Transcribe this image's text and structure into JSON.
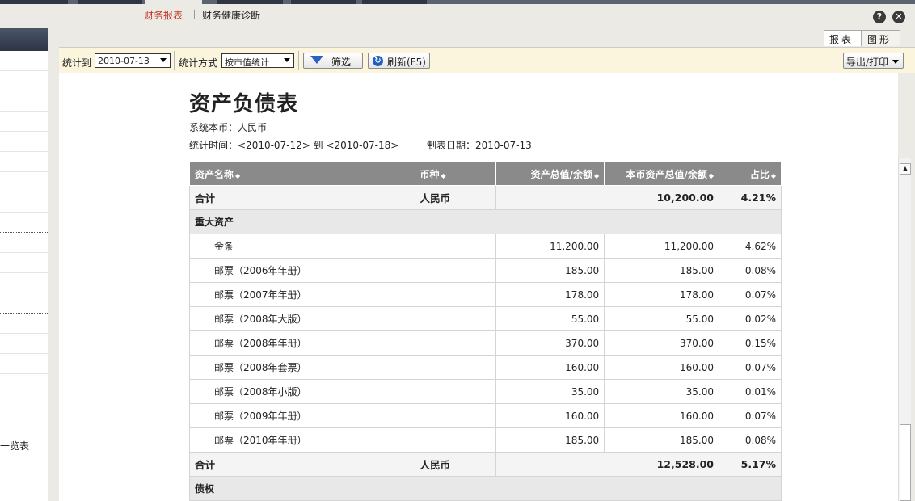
{
  "menu": {
    "report_tab": "财务报表",
    "health_tab": "财务健康诊断"
  },
  "window_buttons": {
    "help": "?",
    "close": "✕"
  },
  "sidebar": {
    "visible_item": "一览表"
  },
  "view_tabs": {
    "report": "报表",
    "chart": "图形"
  },
  "toolbar": {
    "stat_to_label": "统计到",
    "stat_to_value": "2010-07-13",
    "method_label": "统计方式",
    "method_value": "按市值统计",
    "filter_button": "筛选",
    "refresh_button": "刷新(F5)",
    "export_button": "导出/打印"
  },
  "report": {
    "title": "资产负债表",
    "currency_line": "系统本币：人民币",
    "period_line": "统计时间：<2010-07-12> 到 <2010-07-18>",
    "made_date_line": "制表日期：2010-07-13",
    "columns": [
      "资产名称",
      "币种",
      "资产总值/余额",
      "本币资产总值/余额",
      "占比"
    ],
    "rows": [
      {
        "type": "total",
        "name": "合计",
        "currency": "人民币",
        "total": "",
        "local": "10,200.00",
        "ratio": "4.21%"
      },
      {
        "type": "group",
        "name": "重大资产"
      },
      {
        "type": "item",
        "name": "金条",
        "currency": "",
        "total": "11,200.00",
        "local": "11,200.00",
        "ratio": "4.62%"
      },
      {
        "type": "item",
        "name": "邮票（2006年年册）",
        "currency": "",
        "total": "185.00",
        "local": "185.00",
        "ratio": "0.08%"
      },
      {
        "type": "item",
        "name": "邮票（2007年年册）",
        "currency": "",
        "total": "178.00",
        "local": "178.00",
        "ratio": "0.07%"
      },
      {
        "type": "item",
        "name": "邮票（2008年大版）",
        "currency": "",
        "total": "55.00",
        "local": "55.00",
        "ratio": "0.02%"
      },
      {
        "type": "item",
        "name": "邮票（2008年年册）",
        "currency": "",
        "total": "370.00",
        "local": "370.00",
        "ratio": "0.15%"
      },
      {
        "type": "item",
        "name": "邮票（2008年套票）",
        "currency": "",
        "total": "160.00",
        "local": "160.00",
        "ratio": "0.07%"
      },
      {
        "type": "item",
        "name": "邮票（2008年小版）",
        "currency": "",
        "total": "35.00",
        "local": "35.00",
        "ratio": "0.01%"
      },
      {
        "type": "item",
        "name": "邮票（2009年年册）",
        "currency": "",
        "total": "160.00",
        "local": "160.00",
        "ratio": "0.07%"
      },
      {
        "type": "item",
        "name": "邮票（2010年年册）",
        "currency": "",
        "total": "185.00",
        "local": "185.00",
        "ratio": "0.08%"
      },
      {
        "type": "total",
        "name": "合计",
        "currency": "人民币",
        "total": "",
        "local": "12,528.00",
        "ratio": "5.17%"
      },
      {
        "type": "group",
        "name": "债权"
      }
    ]
  }
}
